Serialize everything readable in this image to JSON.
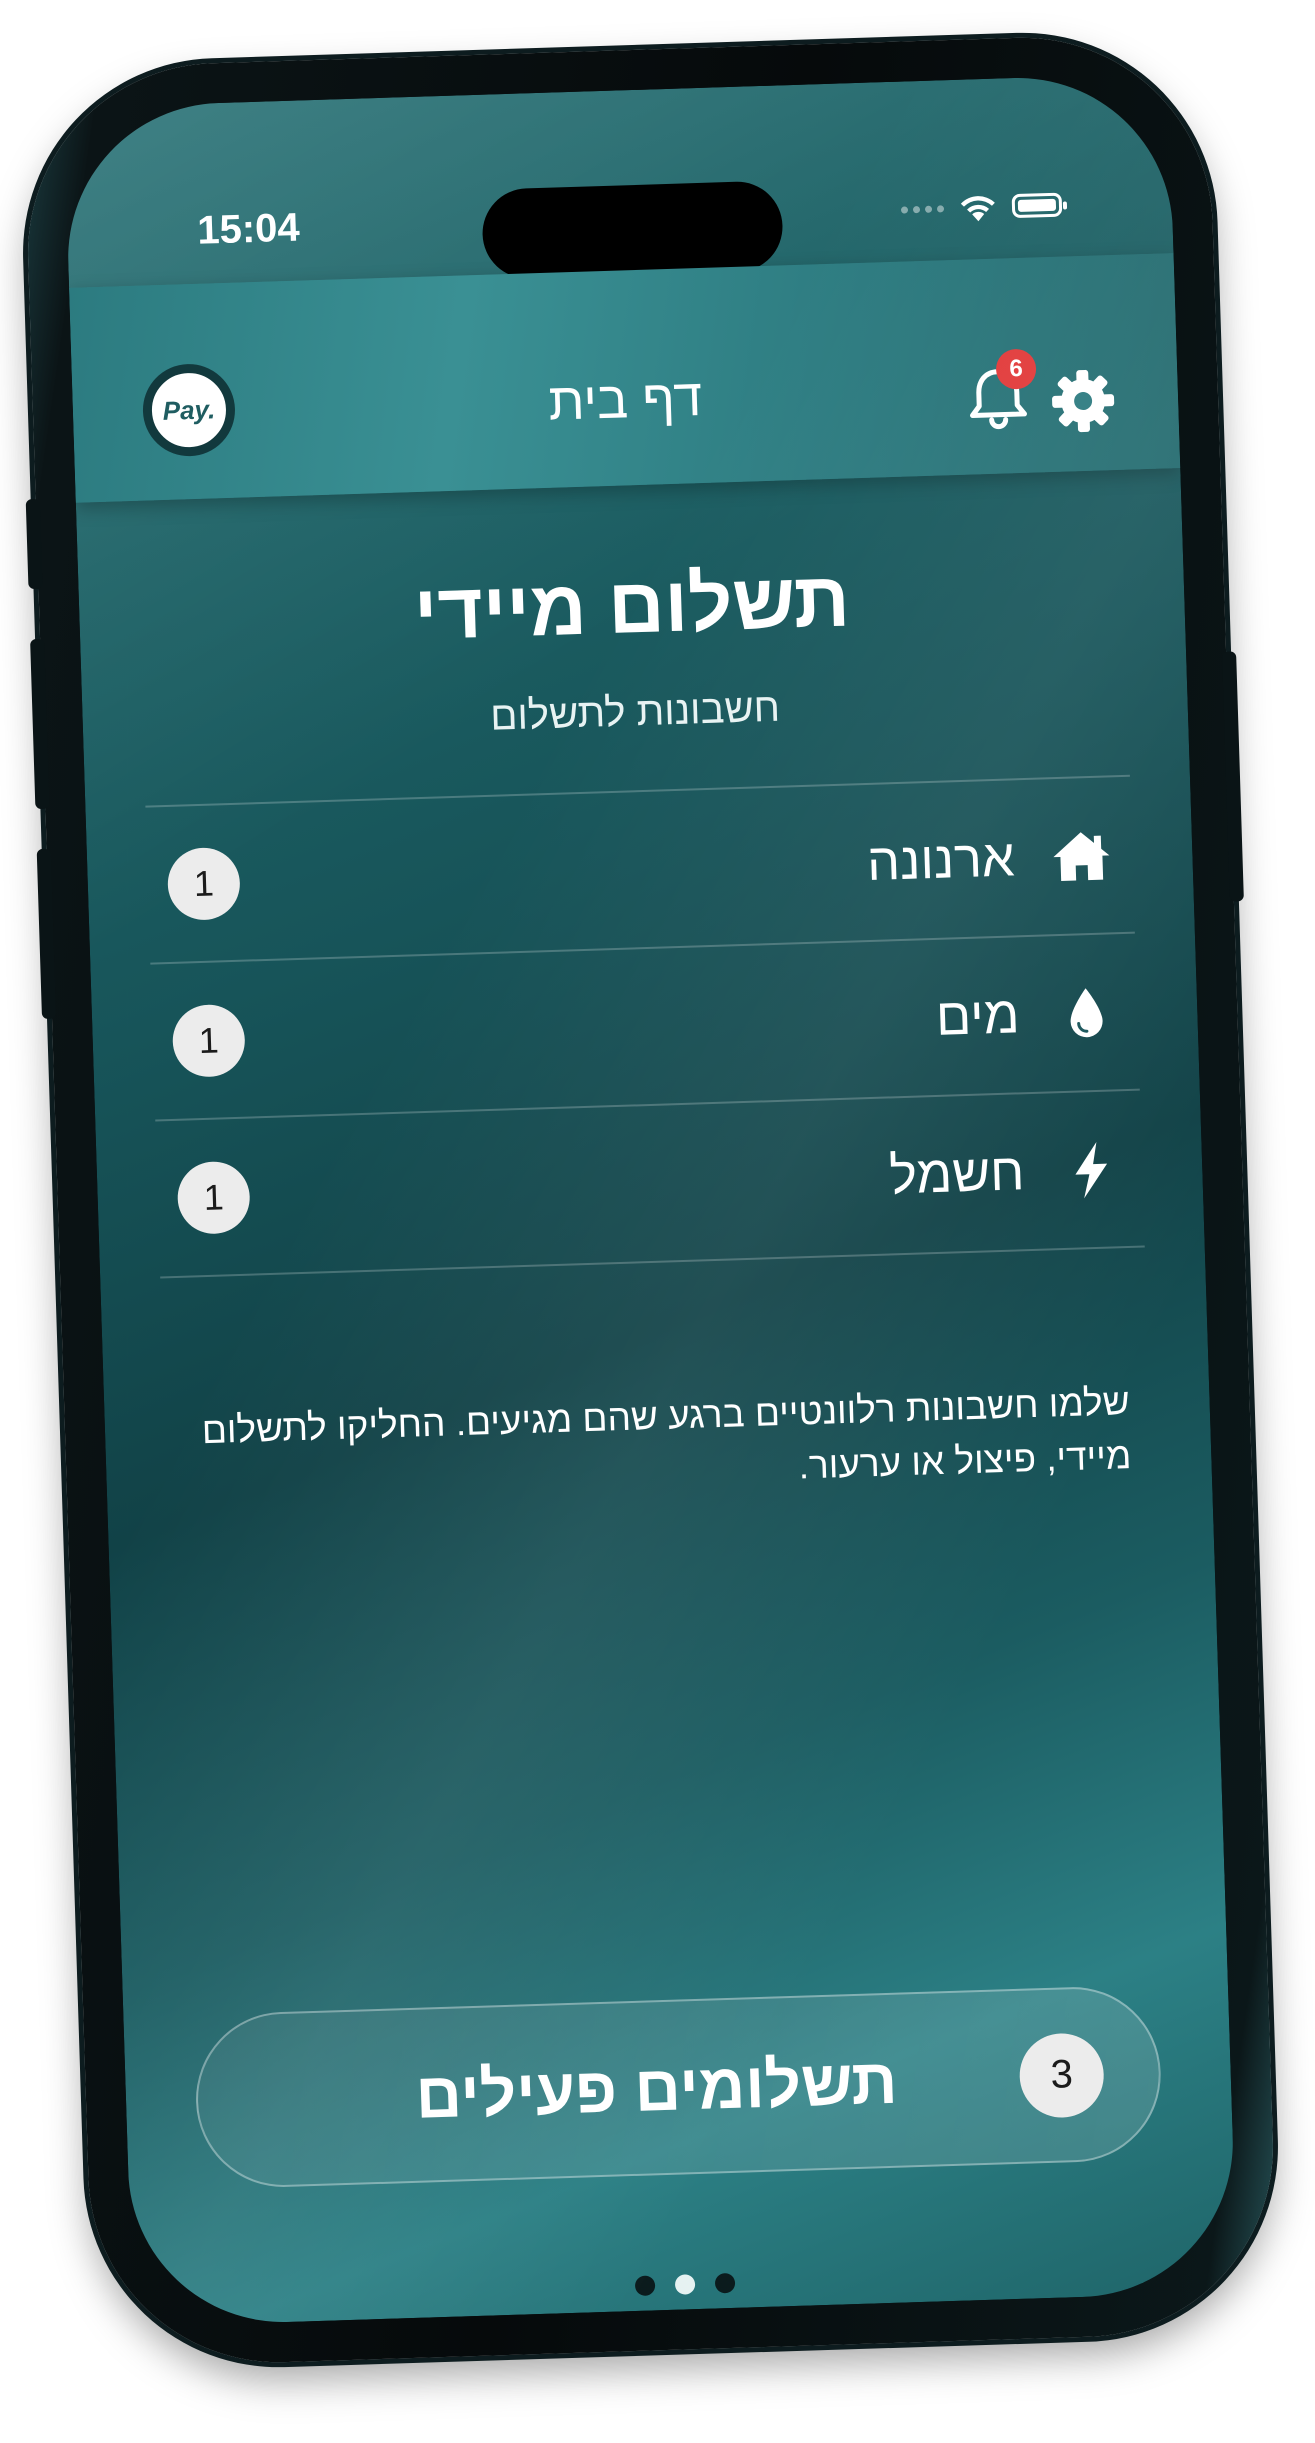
{
  "status_bar": {
    "time": "15:04"
  },
  "header": {
    "logo_text": "Pay.",
    "title": "דף בית",
    "notifications_count": "6"
  },
  "main": {
    "title": "תשלום מיידי",
    "subtitle": "חשבונות לתשלום",
    "bills": [
      {
        "label": "ארנונה",
        "icon": "home-icon",
        "count": "1"
      },
      {
        "label": "מים",
        "icon": "water-drop-icon",
        "count": "1"
      },
      {
        "label": "חשמל",
        "icon": "lightning-icon",
        "count": "1"
      }
    ],
    "description": "שלמו חשבונות רלוונטיים ברגע שהם מגיעים. החליקו לתשלום מיידי, פיצול או ערעור."
  },
  "active_payments": {
    "label": "תשלומים פעילים",
    "count": "3"
  },
  "pagination": {
    "total": 3,
    "current": 2
  },
  "colors": {
    "header": "#358a8e",
    "background": "#175459",
    "badge": "#e23b3b",
    "count_circle": "#ececec"
  }
}
